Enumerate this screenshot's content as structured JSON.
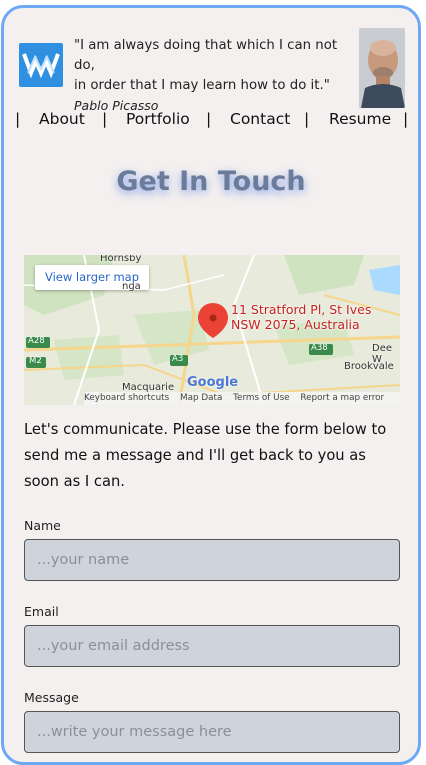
{
  "header": {
    "quote_line1": "\"I am always doing that which I can not do,",
    "quote_line2": "in order that I may learn how to do it.\"",
    "quote_author": "Pablo Picasso"
  },
  "nav": {
    "separator": "|",
    "items": [
      {
        "label": "About"
      },
      {
        "label": "Portfolio"
      },
      {
        "label": "Contact"
      },
      {
        "label": "Resume"
      }
    ]
  },
  "page": {
    "title": "Get In Touch"
  },
  "map": {
    "larger_map_link": "View larger map",
    "address_line1": "11 Stratford Pl, St Ives",
    "address_line2": "NSW 2075, Australia",
    "places": {
      "hornsby": "Hornsby",
      "pymble": "nga",
      "macquarie": "Macquarie",
      "dee_why": "Dee W",
      "brookvale": "Brookvale"
    },
    "roads": {
      "a28": "A28",
      "m2": "M2",
      "a3": "A3",
      "a38": "A38"
    },
    "provider": "Google",
    "footer": {
      "shortcuts": "Keyboard shortcuts",
      "map_data": "Map Data",
      "terms": "Terms of Use",
      "report": "Report a map error"
    }
  },
  "form": {
    "intro": "Let's communicate. Please use the form below to send me a message and I'll get back to you as soon as I can.",
    "name_label": "Name",
    "name_placeholder": "...your name",
    "email_label": "Email",
    "email_placeholder": "...your email address",
    "message_label": "Message",
    "message_placeholder": "...write your message here"
  },
  "colors": {
    "accent_border": "#6ea8f5",
    "logo_bg": "#2f8fe0",
    "title": "#6b7c9b",
    "field_bg": "#cfd3dc",
    "map_pin": "#ea4335"
  }
}
